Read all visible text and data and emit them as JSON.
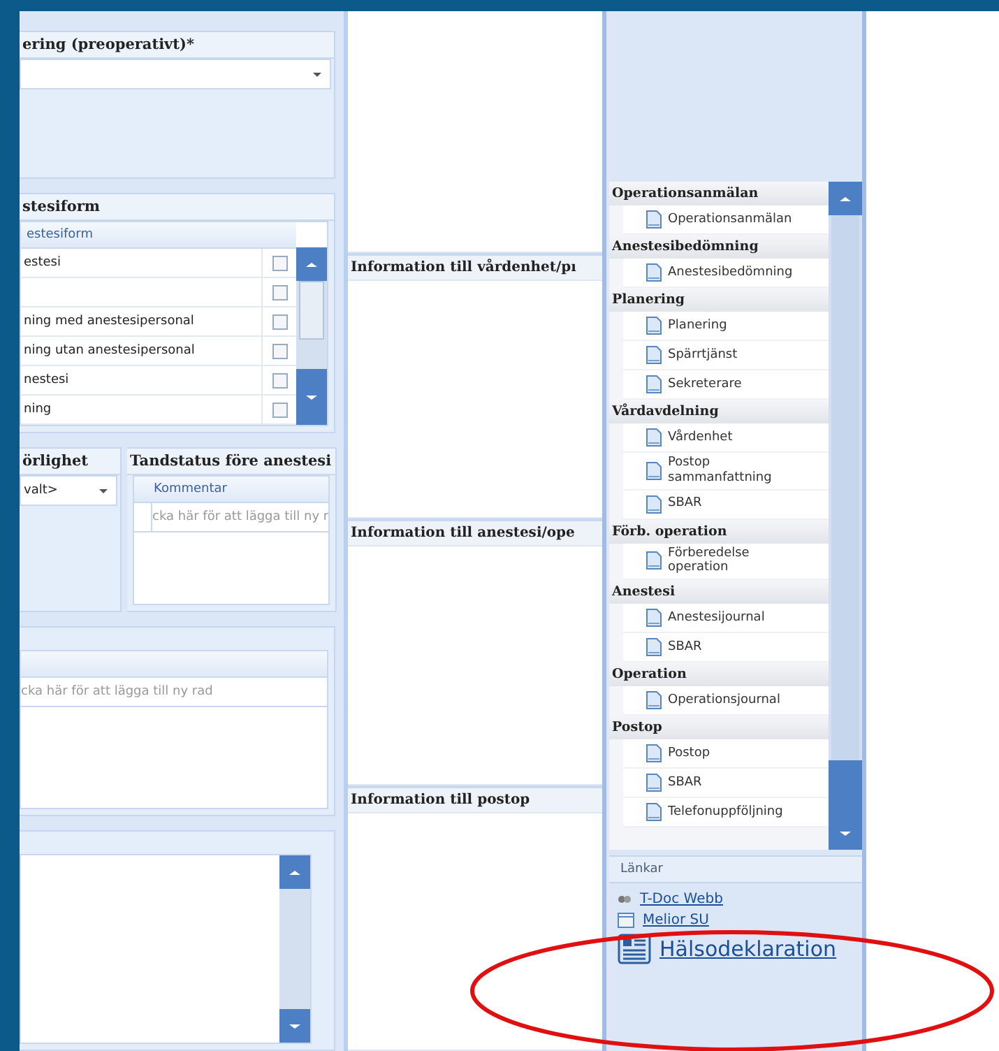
{
  "premedication": {
    "title": "ering (preoperativt)*"
  },
  "anesthesia_form": {
    "title": "stesiform",
    "column": "estesiform",
    "rows": [
      {
        "label": "estesi",
        "checked": false
      },
      {
        "label": "",
        "checked": false
      },
      {
        "label": "ning med anestesipersonal",
        "checked": false
      },
      {
        "label": "ning utan anestesipersonal",
        "checked": false
      },
      {
        "label": "nestesi",
        "checked": false
      },
      {
        "label": "ning",
        "checked": false
      }
    ]
  },
  "priority": {
    "title": "örlighet",
    "value": "valt>"
  },
  "dental_status": {
    "title": "Tandstatus före anestesi",
    "column": "Kommentar",
    "new_row": "cka här för att lägga till ny r"
  },
  "grid_panel": {
    "new_row": "cka här för att lägga till ny rad"
  },
  "info_sections": [
    {
      "title": "Information till vårdenhet/pı"
    },
    {
      "title": "Information till anestesi/ope"
    },
    {
      "title": "Information till postop"
    }
  ],
  "navigator": {
    "groups": [
      {
        "label": "Operationsanmälan",
        "children": [
          {
            "label": "Operationsanmälan"
          }
        ]
      },
      {
        "label": "Anestesibedömning",
        "children": [
          {
            "label": "Anestesibedömning"
          }
        ]
      },
      {
        "label": "Planering",
        "children": [
          {
            "label": "Planering"
          },
          {
            "label": "Spärrtjänst"
          },
          {
            "label": "Sekreterare"
          }
        ]
      },
      {
        "label": "Vårdavdelning",
        "children": [
          {
            "label": "Vårdenhet"
          },
          {
            "label": "Postop sammanfattning"
          },
          {
            "label": "SBAR"
          }
        ]
      },
      {
        "label": "Förb. operation",
        "children": [
          {
            "label": "Förberedelse operation"
          }
        ]
      },
      {
        "label": "Anestesi",
        "children": [
          {
            "label": "Anestesijournal"
          },
          {
            "label": "SBAR"
          }
        ]
      },
      {
        "label": "Operation",
        "children": [
          {
            "label": "Operationsjournal"
          }
        ]
      },
      {
        "label": "Postop",
        "children": [
          {
            "label": "Postop"
          },
          {
            "label": "SBAR"
          },
          {
            "label": "Telefonuppföljning"
          }
        ]
      }
    ]
  },
  "links": {
    "title": "Länkar",
    "items": [
      {
        "label": "T-Doc Webb",
        "kind": "web"
      },
      {
        "label": "Melior SU",
        "kind": "app"
      },
      {
        "label": "Hälsodeklaration",
        "kind": "form"
      }
    ]
  }
}
